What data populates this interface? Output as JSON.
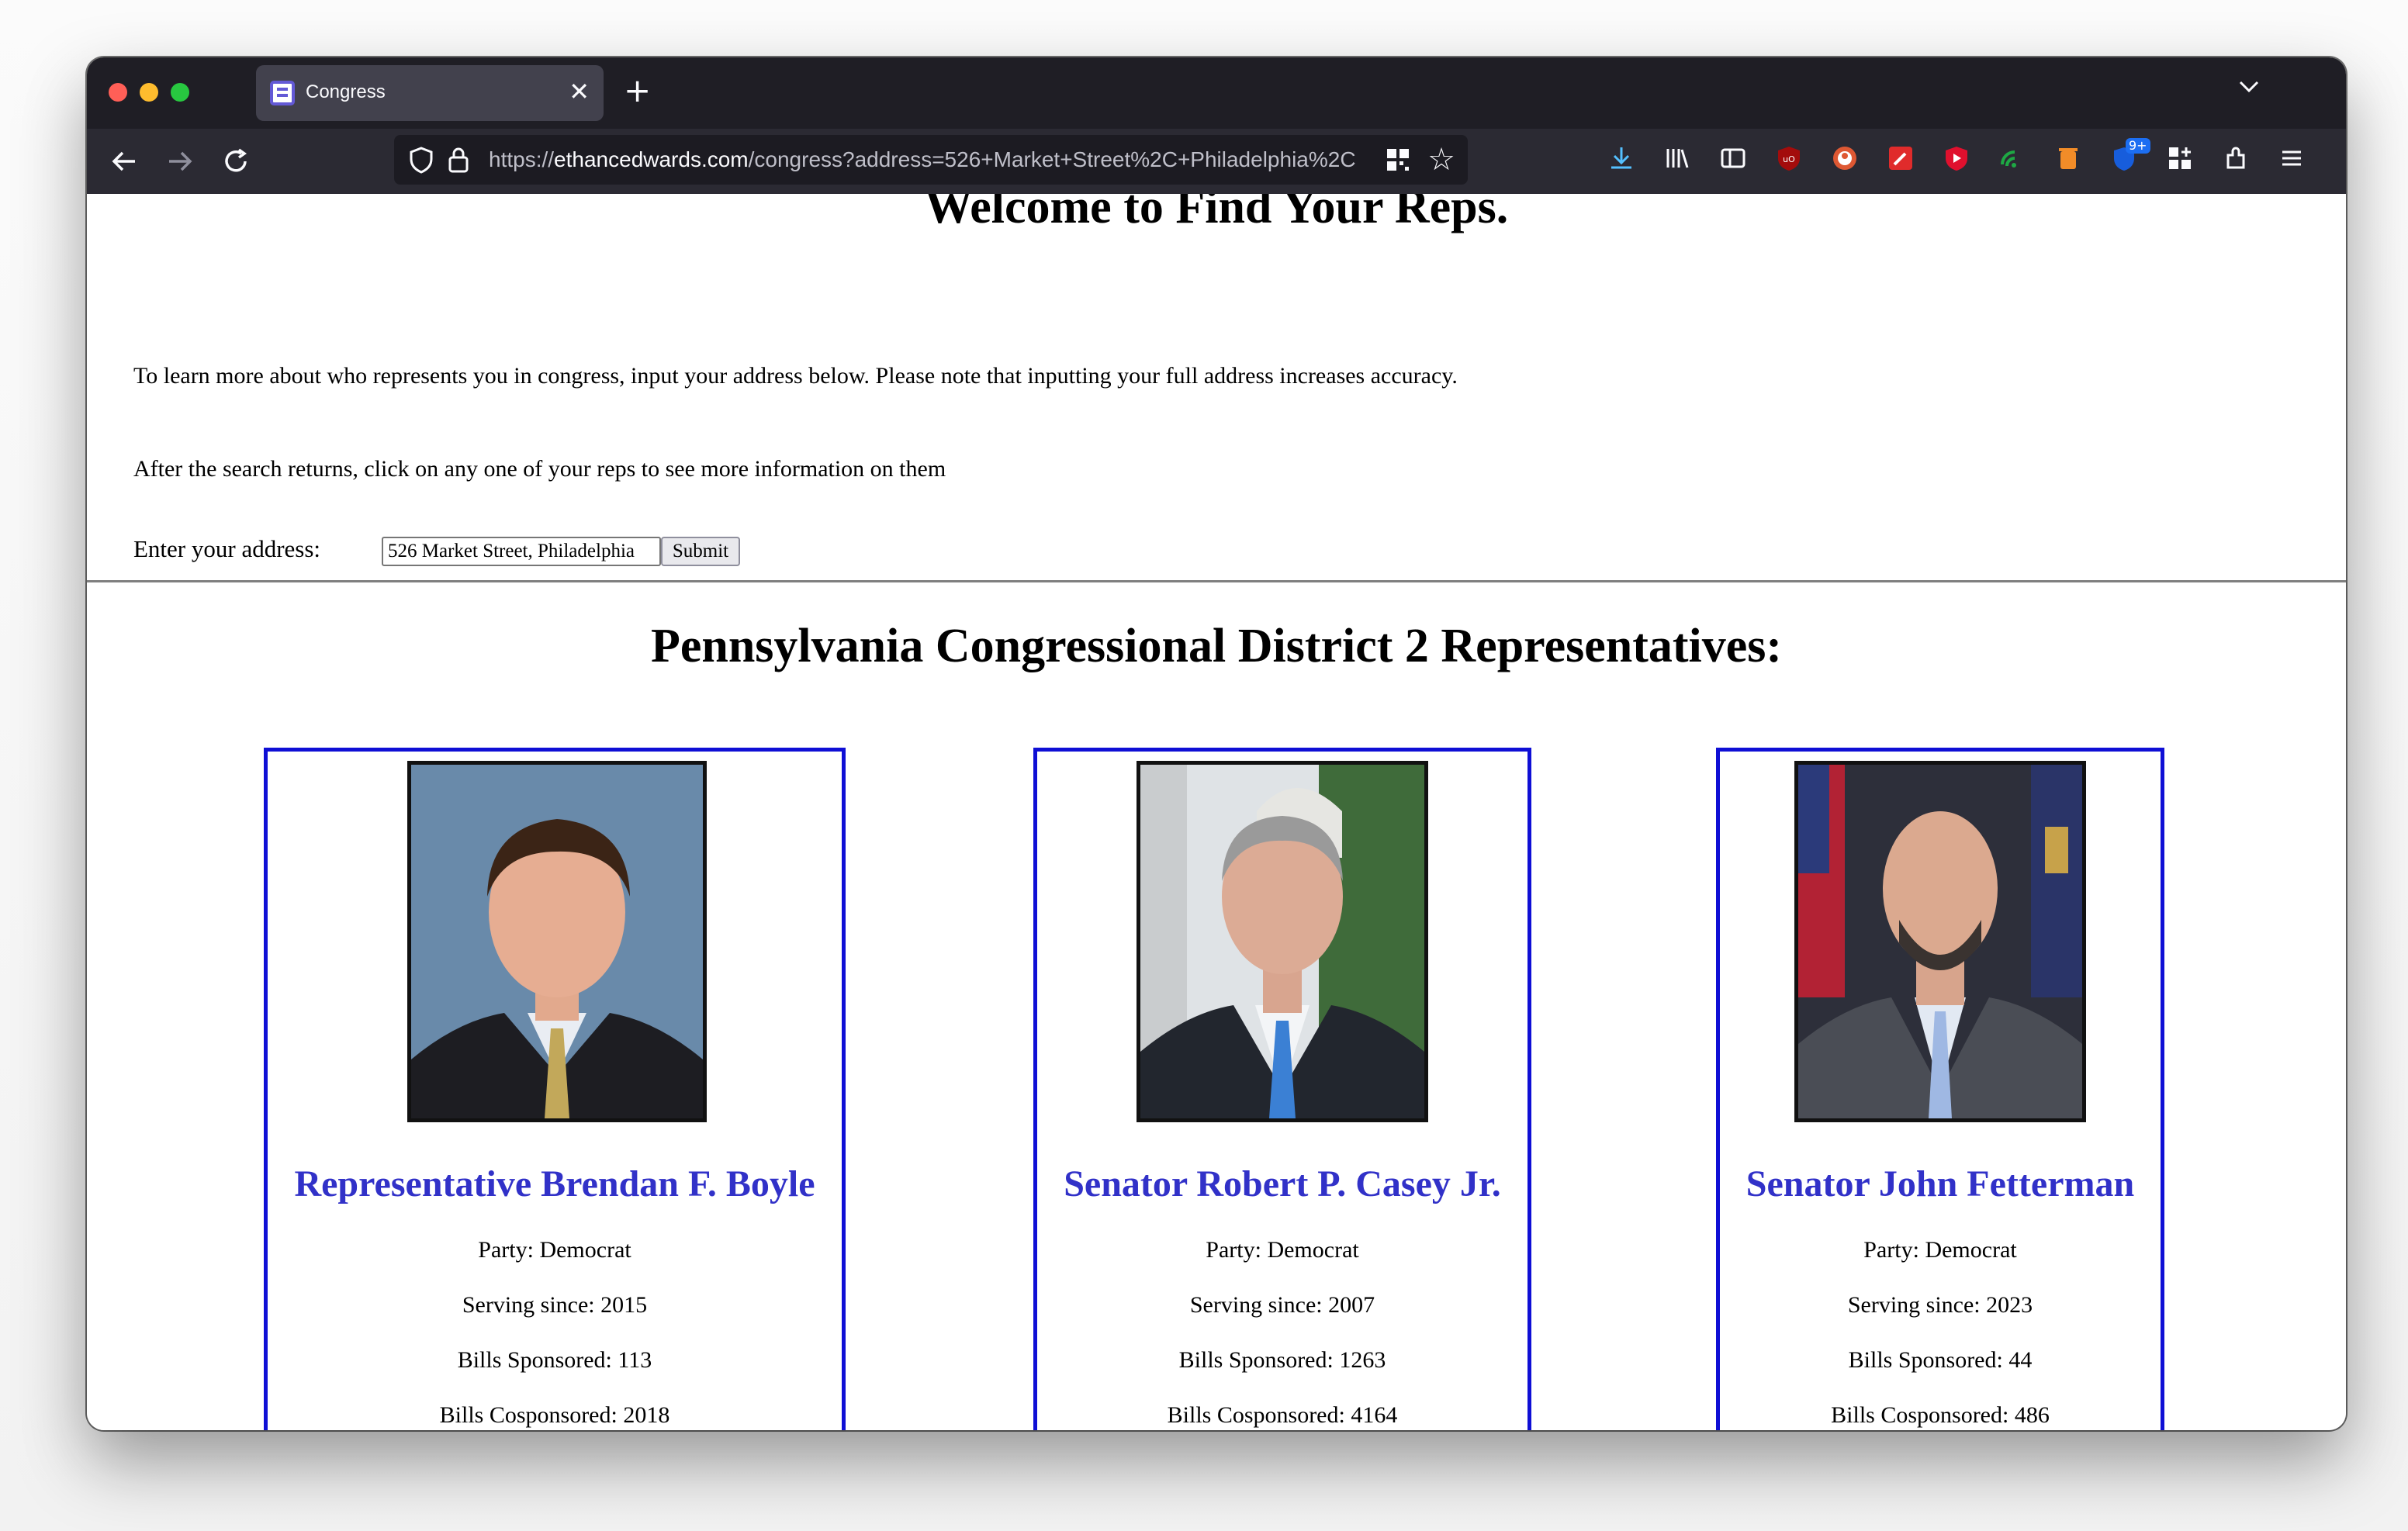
{
  "browser": {
    "tab_title": "Congress",
    "tab_close": "✕",
    "new_tab": "+",
    "url_scheme": "https://",
    "url_host": "ethancedwards.com",
    "url_path": "/congress?address=526+Market+Street%2C+Philadelphia%2C",
    "extension_badge": "9+"
  },
  "page": {
    "welcome_heading": "Welcome to Find Your Reps.",
    "intro_text": "To learn more about who represents you in congress, input your address below. Please note that inputting your full address increases accuracy.",
    "instruction_text": "After the search returns, click on any one of your reps to see more information on them",
    "address_label": "Enter your address:",
    "address_value": "526 Market Street, Philadelphia",
    "submit_label": "Submit",
    "district_heading": "Pennsylvania Congressional District 2 Representatives:"
  },
  "reps": [
    {
      "name": "Representative Brendan F. Boyle",
      "party": "Party: Democrat",
      "serving_since": "Serving since: 2015",
      "bills_sponsored": "Bills Sponsored: 113",
      "bills_cosponsored": "Bills Cosponsored: 2018"
    },
    {
      "name": "Senator Robert P. Casey Jr.",
      "party": "Party: Democrat",
      "serving_since": "Serving since: 2007",
      "bills_sponsored": "Bills Sponsored: 1263",
      "bills_cosponsored": "Bills Cosponsored: 4164"
    },
    {
      "name": "Senator John Fetterman",
      "party": "Party: Democrat",
      "serving_since": "Serving since: 2023",
      "bills_sponsored": "Bills Sponsored: 44",
      "bills_cosponsored": "Bills Cosponsored: 486"
    }
  ],
  "colors": {
    "card_border": "#0f0fd5",
    "rep_name": "#3131c8",
    "toolbar_bg": "#2b2a33",
    "tabbar_bg": "#1f1e25"
  }
}
